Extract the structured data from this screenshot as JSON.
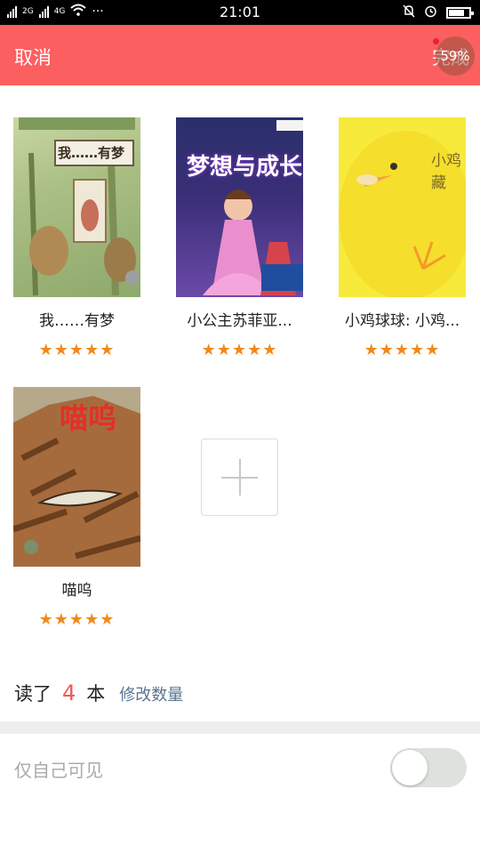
{
  "status_bar": {
    "network_left": "2G",
    "network_right": "4G",
    "more": "···",
    "time": "21:01",
    "icons": [
      "signal-icon",
      "wifi-icon",
      "bell-off-icon",
      "alarm-icon",
      "battery-icon"
    ]
  },
  "header": {
    "cancel_label": "取消",
    "done_label": "完成",
    "badge_text": "59%",
    "background": "#fc5f5f"
  },
  "books": [
    {
      "title": "我……有梦",
      "rating": 5,
      "cover_text": "我……有梦"
    },
    {
      "title": "小公主苏菲亚...",
      "rating": 5,
      "cover_text": "梦想与成长"
    },
    {
      "title": "小鸡球球: 小鸡...",
      "rating": 5,
      "cover_text": "小鸡藏"
    },
    {
      "title": "喵呜",
      "rating": 5,
      "cover_text": "喵呜"
    }
  ],
  "add_button": {
    "icon": "plus-icon"
  },
  "read_count": {
    "prefix": "读了",
    "count": "4",
    "unit": "本",
    "edit_label": "修改数量"
  },
  "privacy": {
    "label": "仅自己可见",
    "enabled": false
  },
  "colors": {
    "accent": "#fc5f5f",
    "star": "#f08a1a",
    "count": "#f05a5a",
    "link": "#5a7590"
  }
}
